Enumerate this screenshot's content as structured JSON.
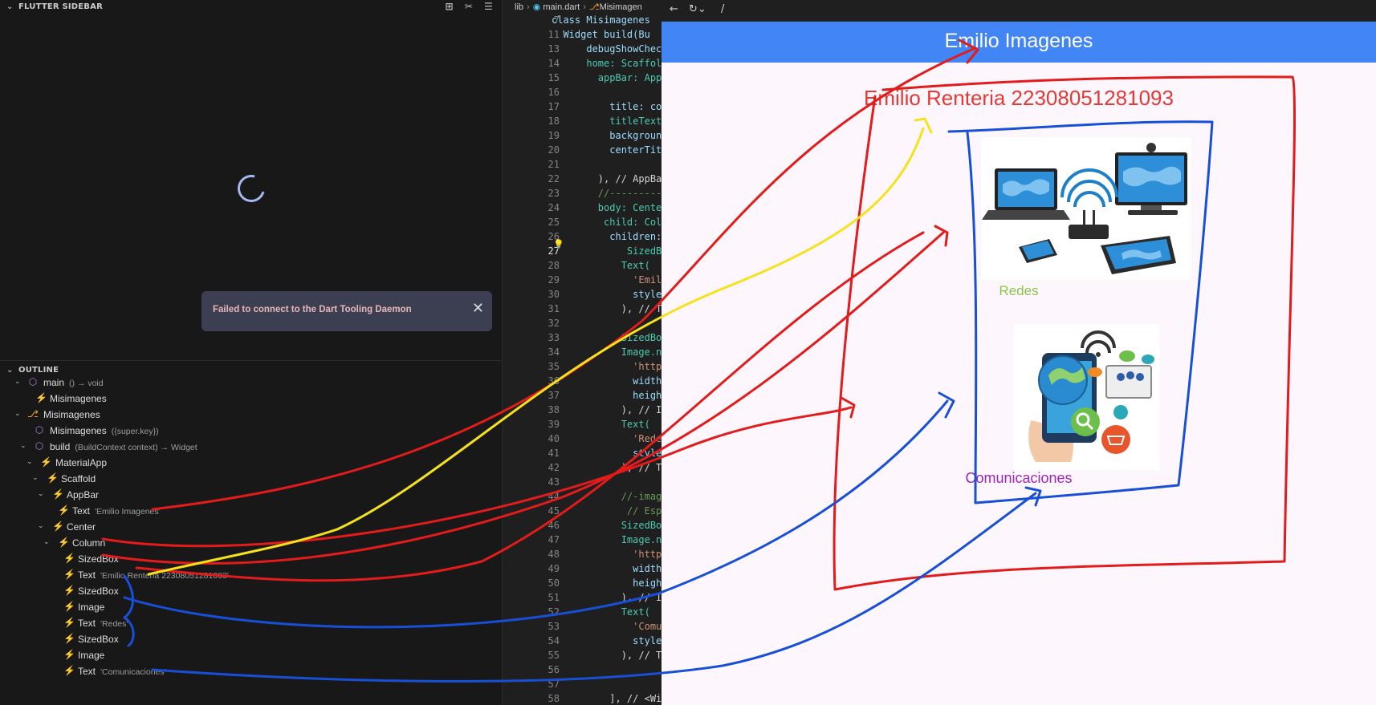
{
  "sidebar": {
    "flutter_panel_title": "FLUTTER SIDEBAR",
    "toast_message": "Failed to connect to the Dart Tooling Daemon",
    "outline_title": "OUTLINE",
    "outline": [
      {
        "label": "main",
        "detail": "() → void"
      },
      {
        "label": "Misimagenes",
        "detail": ""
      },
      {
        "label": "Misimagenes",
        "detail": ""
      },
      {
        "label": "Misimagenes",
        "detail": "({super.key})"
      },
      {
        "label": "build",
        "detail": "(BuildContext context) → Widget"
      },
      {
        "label": "MaterialApp",
        "detail": ""
      },
      {
        "label": "Scaffold",
        "detail": ""
      },
      {
        "label": "AppBar",
        "detail": ""
      },
      {
        "label": "Text",
        "detail": "'Emilio Imagenes'"
      },
      {
        "label": "Center",
        "detail": ""
      },
      {
        "label": "Column",
        "detail": ""
      },
      {
        "label": "SizedBox",
        "detail": ""
      },
      {
        "label": "Text",
        "detail": "'Emilio Renteria 22308051281093'"
      },
      {
        "label": "SizedBox",
        "detail": ""
      },
      {
        "label": "Image",
        "detail": ""
      },
      {
        "label": "Text",
        "detail": "'Redes'"
      },
      {
        "label": "SizedBox",
        "detail": ""
      },
      {
        "label": "Image",
        "detail": ""
      },
      {
        "label": "Text",
        "detail": "'Comunicaciones'"
      }
    ]
  },
  "editor": {
    "breadcrumb": [
      "lib",
      "main.dart",
      "Misimagen"
    ],
    "lines": [
      {
        "n": "7",
        "code": "class Misimagenes"
      },
      {
        "n": "11",
        "code": "  Widget build(Bu"
      },
      {
        "n": "13",
        "code": "      debugShowChecke"
      },
      {
        "n": "14",
        "code": "      home: Scaffol"
      },
      {
        "n": "15",
        "code": "        appBar: App"
      },
      {
        "n": "16",
        "code": ""
      },
      {
        "n": "17",
        "code": "          title: co"
      },
      {
        "n": "18",
        "code": "          titleText"
      },
      {
        "n": "19",
        "code": "          backgroun"
      },
      {
        "n": "20",
        "code": "          centerTit"
      },
      {
        "n": "21",
        "code": ""
      },
      {
        "n": "22",
        "code": "        ), // AppBa"
      },
      {
        "n": "23",
        "code": "        //---------"
      },
      {
        "n": "24",
        "code": "        body: Center"
      },
      {
        "n": "25",
        "code": "         child: Colu"
      },
      {
        "n": "26",
        "code": "          children:"
      },
      {
        "n": "27",
        "code": "             SizedB"
      },
      {
        "n": "28",
        "code": "            Text("
      },
      {
        "n": "29",
        "code": "              'Emil"
      },
      {
        "n": "30",
        "code": "              style"
      },
      {
        "n": "31",
        "code": "            ), // T"
      },
      {
        "n": "32",
        "code": ""
      },
      {
        "n": "33",
        "code": "            SizedBo"
      },
      {
        "n": "34",
        "code": "            Image.n"
      },
      {
        "n": "35",
        "code": "              'http"
      },
      {
        "n": "36",
        "code": "              width"
      },
      {
        "n": "37",
        "code": "              heigh"
      },
      {
        "n": "38",
        "code": "            ), // I"
      },
      {
        "n": "39",
        "code": "            Text("
      },
      {
        "n": "40",
        "code": "              'Rede"
      },
      {
        "n": "41",
        "code": "              style"
      },
      {
        "n": "42",
        "code": "            ), // T"
      },
      {
        "n": "43",
        "code": ""
      },
      {
        "n": "44",
        "code": "            //-imag"
      },
      {
        "n": "45",
        "code": "             // Espa"
      },
      {
        "n": "46",
        "code": "            SizedBo"
      },
      {
        "n": "47",
        "code": "            Image.n"
      },
      {
        "n": "48",
        "code": "              'http"
      },
      {
        "n": "49",
        "code": "              width"
      },
      {
        "n": "50",
        "code": "              heigh"
      },
      {
        "n": "51",
        "code": "            ), // I"
      },
      {
        "n": "52",
        "code": "            Text("
      },
      {
        "n": "53",
        "code": "              'Comu"
      },
      {
        "n": "54",
        "code": "              style"
      },
      {
        "n": "55",
        "code": "            ), // T"
      },
      {
        "n": "56",
        "code": ""
      },
      {
        "n": "57",
        "code": ""
      },
      {
        "n": "58",
        "code": "          ], // <Wi"
      }
    ]
  },
  "preview": {
    "address": "/",
    "appbar_title": "Emilio Imagenes",
    "name_text": "Emilio Renteria 22308051281093",
    "caption1": "Redes",
    "caption2": "Comunicaciones",
    "colors": {
      "appbar": "#4285f4",
      "name": "#e53935",
      "caption1": "#8bc34a",
      "caption2": "#9c27b0",
      "background": "#fdf7fd"
    }
  },
  "icons": [
    "chevron-down-icon",
    "flutter-widget-icon",
    "function-icon",
    "class-icon",
    "loading-spinner-icon",
    "close-icon",
    "back-icon",
    "reload-icon",
    "lightbulb-icon"
  ]
}
